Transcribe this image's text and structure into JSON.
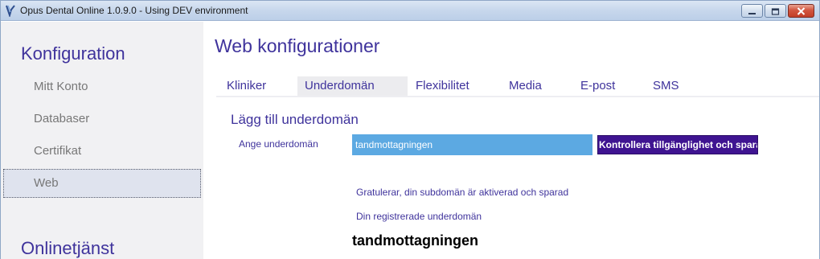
{
  "window": {
    "title": "Opus Dental Online 1.0.9.0 - Using DEV environment",
    "icon": "opus-app-icon",
    "controls": {
      "minimize": "minimize-icon",
      "maximize": "maximize-icon",
      "close": "close-icon"
    }
  },
  "sidebar": {
    "heading": "Konfiguration",
    "items": [
      {
        "label": "Mitt Konto",
        "selected": false
      },
      {
        "label": "Databaser",
        "selected": false
      },
      {
        "label": "Certifikat",
        "selected": false
      },
      {
        "label": "Web",
        "selected": true
      }
    ],
    "heading2": "Onlinetjänst"
  },
  "main": {
    "title": "Web konfigurationer",
    "tabs": [
      {
        "label": "Kliniker",
        "active": false
      },
      {
        "label": "Underdomän",
        "active": true
      },
      {
        "label": "Flexibilitet",
        "active": false
      },
      {
        "label": "Media",
        "active": false
      },
      {
        "label": "E-post",
        "active": false
      },
      {
        "label": "SMS",
        "active": false
      }
    ],
    "section_title": "Lägg till underdomän",
    "field_label": "Ange underdomän",
    "subdomain_value": "tandmottagningen",
    "check_button": "Kontrollera tillgänglighet och spara",
    "success_message": "Gratulerar, din subdomän är aktiverad och sparad",
    "registered_label": "Din registrerade underdomän",
    "registered_value": "tandmottagningen"
  },
  "colors": {
    "accent": "#3f339c",
    "input_bg": "#5ca9e2",
    "button_bg": "#3f1491",
    "sidebar_bg": "#f1f1f3",
    "selected_bg": "#dfe3ee"
  }
}
